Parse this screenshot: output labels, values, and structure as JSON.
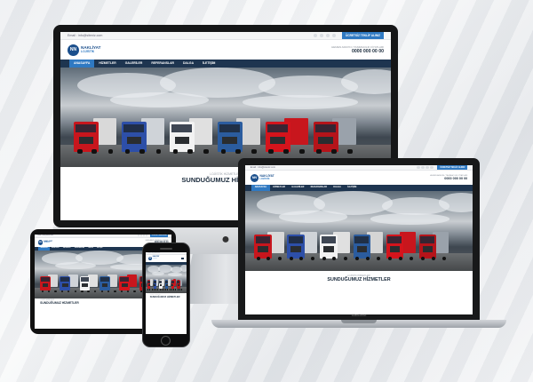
{
  "site": {
    "email": "Email : info@siteniz.com",
    "quote_button": "ÜCRETSİZ TEKLİF ALINIZ",
    "logo_abbr": "NN",
    "logo_line1": "NAKLİYAT",
    "logo_line2": "LOJİSTİK",
    "phone_hint": "HEMEN ARAYIN / TAŞIMACILIK FİYATLARI",
    "phone": "0000 000 00 00",
    "nav": [
      "ANASAYFA",
      "HİZMETLER",
      "GALERİLER",
      "REFERANSLAR",
      "DALGA",
      "İLETİŞİM"
    ],
    "kicker": "LOJİSTİK HİZMETLERİ",
    "section_title": "SUNDUĞUMUZ HİZMETLER"
  },
  "devices": {
    "laptop_brand": "MacBook",
    "apple_logo": "apple-logo"
  },
  "colors": {
    "nav_bg": "#1e3550",
    "accent": "#2f79c2",
    "logo": "#1b4f8c"
  }
}
